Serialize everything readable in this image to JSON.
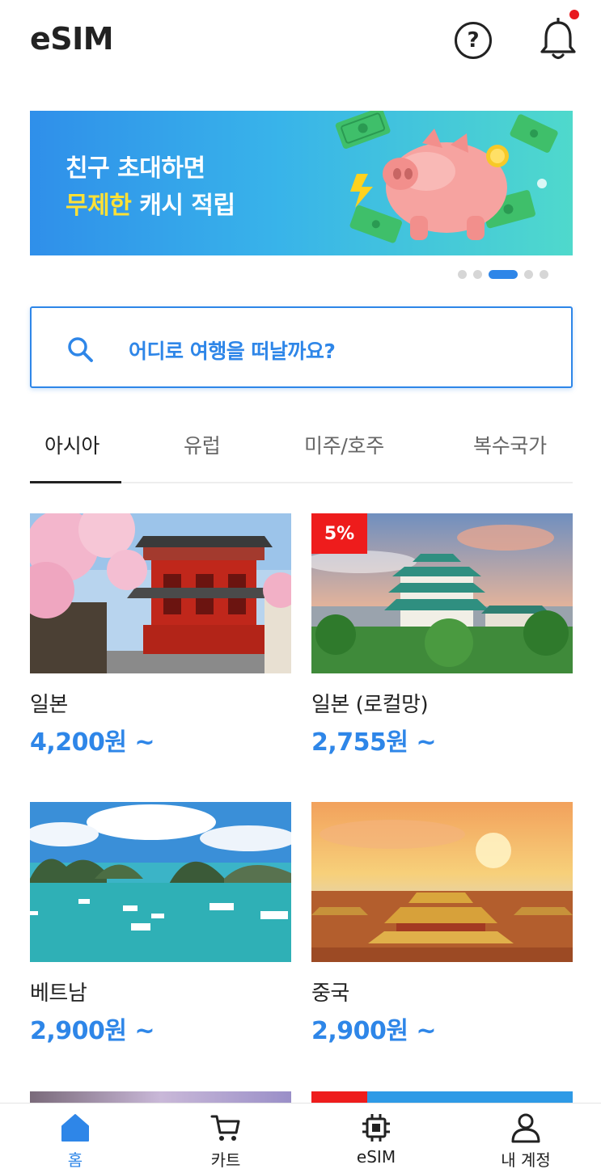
{
  "header": {
    "title": "eSIM",
    "help_icon": "help-circle-icon",
    "bell_icon": "bell-icon",
    "notification_dot_color": "#e8191f"
  },
  "banner": {
    "line1": "친구 초대하면",
    "line2_highlight": "무제한",
    "line2_rest": " 캐시 적립",
    "highlight_color": "#ffe135",
    "art": "piggy-bank-money-illustration"
  },
  "carousel": {
    "count": 5,
    "active_index": 2
  },
  "search": {
    "placeholder": "어디로 여행을 떠날까요?",
    "icon": "search-icon"
  },
  "tabs": [
    {
      "label": "아시아",
      "active": true
    },
    {
      "label": "유럽",
      "active": false
    },
    {
      "label": "미주/호주",
      "active": false
    },
    {
      "label": "복수국가",
      "active": false
    }
  ],
  "products": [
    {
      "name": "일본",
      "price": "4,200원 ~",
      "badge": "",
      "image": "tokyo-temple-cherry-blossom"
    },
    {
      "name": "일본 (로컬망)",
      "price": "2,755원 ~",
      "badge": "5%",
      "image": "nagoya-castle"
    },
    {
      "name": "베트남",
      "price": "2,900원 ~",
      "badge": "",
      "image": "halong-bay"
    },
    {
      "name": "중국",
      "price": "2,900원 ~",
      "badge": "",
      "image": "forbidden-city-sunset"
    }
  ],
  "bottom_nav": [
    {
      "label": "홈",
      "icon": "home-icon",
      "active": true
    },
    {
      "label": "카트",
      "icon": "cart-icon",
      "active": false
    },
    {
      "label": "eSIM",
      "icon": "chip-icon",
      "active": false
    },
    {
      "label": "내 계정",
      "icon": "user-icon",
      "active": false
    }
  ],
  "colors": {
    "accent": "#2e86e8",
    "badge": "#ee1c1c",
    "text": "#222222"
  }
}
